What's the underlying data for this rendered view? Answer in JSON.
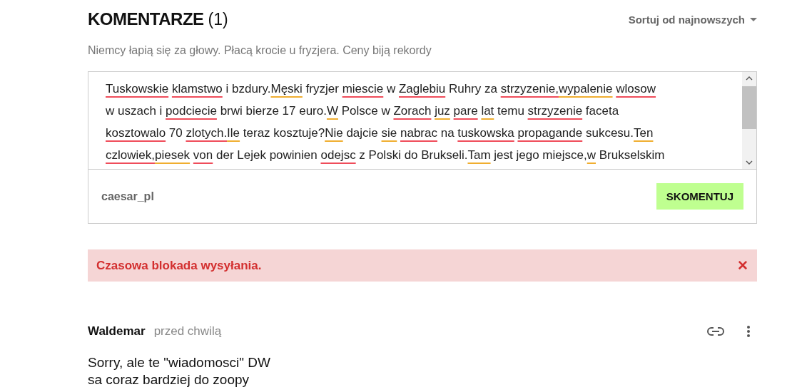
{
  "header": {
    "title": "KOMENTARZE",
    "count": "(1)",
    "sort": "Sortuj od najnowszych"
  },
  "article_title": "Niemcy łapią się za głowy. Płacą krocie u fryzjera. Ceny biją rekordy",
  "editor": {
    "lines": [
      [
        {
          "text": "Tuskowskie ",
          "kind": "spelling"
        },
        {
          "text": "klamstwo",
          "kind": "spelling"
        },
        {
          "text": " i bzdury."
        },
        {
          "text": "Męski",
          "kind": "grammar"
        },
        {
          "text": " fryzjer "
        },
        {
          "text": "miescie",
          "kind": "spelling"
        },
        {
          "text": " w "
        },
        {
          "text": "Zaglebiu",
          "kind": "spelling"
        },
        {
          "text": " Ruhry za "
        },
        {
          "text": "strzyzenie,",
          "kind": "spelling"
        },
        {
          "text": "wypalenie ",
          "kind": "grammar"
        },
        {
          "text": "wlosow",
          "kind": "spelling"
        }
      ],
      [
        {
          "text": "w uszach i "
        },
        {
          "text": "podciecie",
          "kind": "spelling"
        },
        {
          "text": " brwi bierze 17 euro."
        },
        {
          "text": "W",
          "kind": "grammar"
        },
        {
          "text": " Polsce w "
        },
        {
          "text": "Zorach ",
          "kind": "spelling"
        },
        {
          "text": "juz ",
          "kind": "grammar"
        },
        {
          "text": "pare ",
          "kind": "spelling"
        },
        {
          "text": "lat",
          "kind": "grammar"
        },
        {
          "text": " temu "
        },
        {
          "text": "strzyzenie",
          "kind": "spelling"
        },
        {
          "text": " faceta"
        }
      ],
      [
        {
          "text": "kosztowalo",
          "kind": "spelling"
        },
        {
          "text": " 70 "
        },
        {
          "text": "zlotych.",
          "kind": "spelling"
        },
        {
          "text": "Ile",
          "kind": "grammar"
        },
        {
          "text": " teraz kosztuje?"
        },
        {
          "text": "Nie",
          "kind": "grammar"
        },
        {
          "text": " dajcie "
        },
        {
          "text": "sie ",
          "kind": "grammar"
        },
        {
          "text": "nabrac",
          "kind": "spelling"
        },
        {
          "text": " na "
        },
        {
          "text": "tuskowska ",
          "kind": "spelling"
        },
        {
          "text": "propagande",
          "kind": "spelling"
        },
        {
          "text": " sukcesu."
        },
        {
          "text": "Ten",
          "kind": "grammar"
        }
      ],
      [
        {
          "text": "czlowiek,",
          "kind": "spelling"
        },
        {
          "text": "piesek ",
          "kind": "grammar"
        },
        {
          "text": "von",
          "kind": "spelling"
        },
        {
          "text": " der Lejek powinien "
        },
        {
          "text": "odejsc",
          "kind": "spelling"
        },
        {
          "text": " z Polski do Brukseli."
        },
        {
          "text": "Tam",
          "kind": "grammar"
        },
        {
          "text": " jest jego miejsce,"
        },
        {
          "text": "w",
          "kind": "grammar"
        },
        {
          "text": " Brukselskim"
        }
      ]
    ],
    "user": "caesar_pl",
    "submit": "SKOMENTUJ"
  },
  "alert": {
    "message": "Czasowa blokada wysyłania.",
    "close": "✕"
  },
  "comments": [
    {
      "author": "Waldemar",
      "time": "przed chwilą",
      "lines": [
        "Sorry, ale te \"wiadomosci\" DW",
        "sa coraz bardziej do zoopy"
      ]
    }
  ]
}
